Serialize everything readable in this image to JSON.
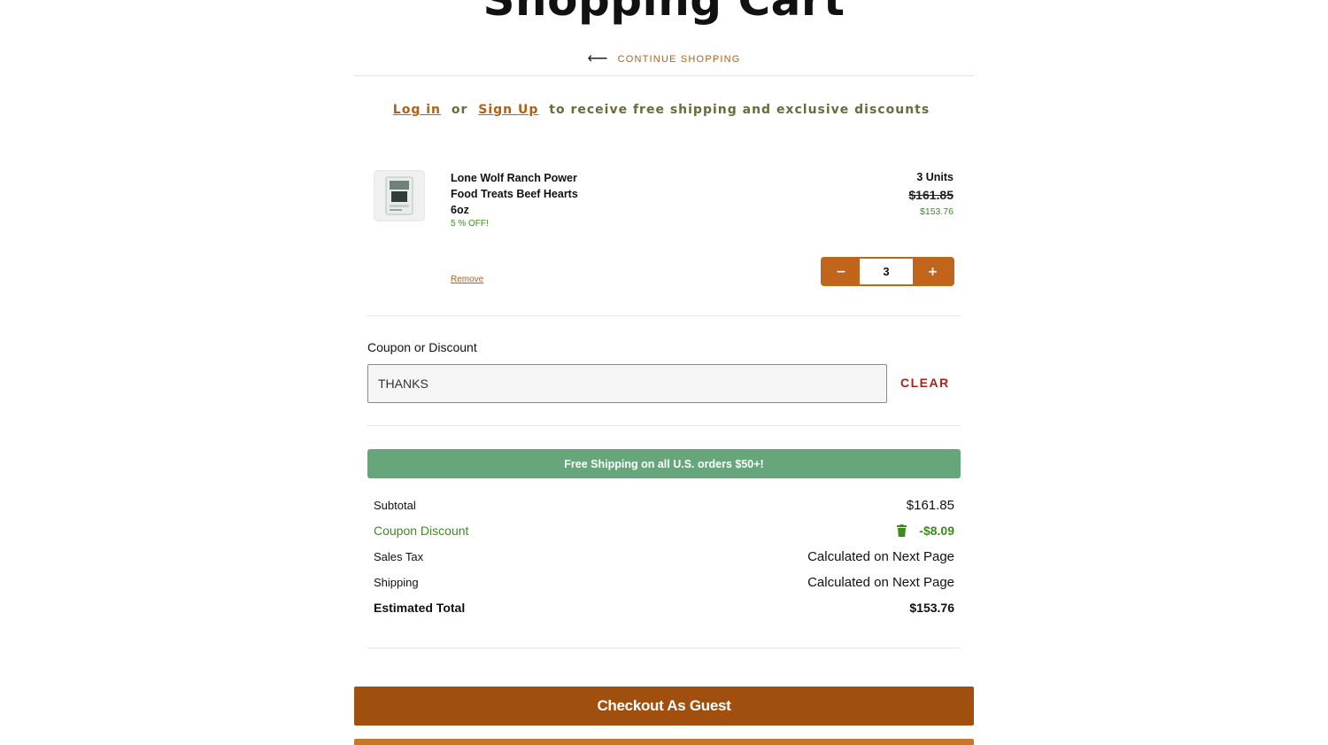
{
  "page": {
    "title": "Shopping Cart"
  },
  "nav": {
    "continue_label": "CONTINUE SHOPPING",
    "arrow_icon": "arrow-left-icon"
  },
  "login_banner": {
    "login_label": "Log in",
    "or_text": "or",
    "signup_label": "Sign Up",
    "message": "to receive free shipping and exclusive discounts"
  },
  "cart": {
    "items": [
      {
        "name": "Lone Wolf Ranch Power Food Treats Beef Hearts 6oz",
        "discount_badge": "5 % OFF!",
        "units": "3 Units",
        "original_price": "$161.85",
        "sale_price": "$153.76",
        "remove_label": "Remove",
        "quantity": "3",
        "decrement_label": "−",
        "increment_label": "+"
      }
    ]
  },
  "coupon": {
    "label": "Coupon or Discount",
    "value": "THANKS",
    "clear_label": "CLEAR"
  },
  "shipping_banner": "Free Shipping on all U.S. orders $50+!",
  "summary": {
    "subtotal_label": "Subtotal",
    "subtotal_value": "$161.85",
    "coupon_label": "Coupon Discount",
    "coupon_value": "-$8.09",
    "tax_label": "Sales Tax",
    "tax_value": "Calculated on Next Page",
    "shipping_label": "Shipping",
    "shipping_value": "Calculated on Next Page",
    "total_label": "Estimated Total",
    "total_value": "$153.76"
  },
  "actions": {
    "checkout_guest_label": "Checkout As Guest"
  },
  "colors": {
    "accent": "#b25f17",
    "discount_green": "#3d8b1f",
    "banner_green": "#67a57a",
    "checkout_brown": "#a14f0f",
    "clear_red": "#a3261a"
  }
}
